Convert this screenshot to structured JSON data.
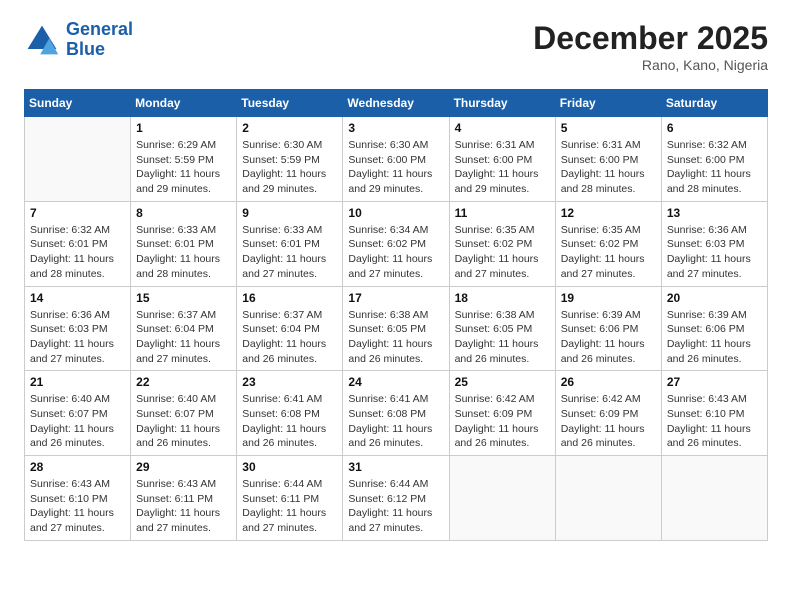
{
  "header": {
    "logo_line1": "General",
    "logo_line2": "Blue",
    "month": "December 2025",
    "location": "Rano, Kano, Nigeria"
  },
  "weekdays": [
    "Sunday",
    "Monday",
    "Tuesday",
    "Wednesday",
    "Thursday",
    "Friday",
    "Saturday"
  ],
  "weeks": [
    [
      {
        "day": "",
        "sunrise": "",
        "sunset": "",
        "daylight": ""
      },
      {
        "day": "1",
        "sunrise": "Sunrise: 6:29 AM",
        "sunset": "Sunset: 5:59 PM",
        "daylight": "Daylight: 11 hours and 29 minutes."
      },
      {
        "day": "2",
        "sunrise": "Sunrise: 6:30 AM",
        "sunset": "Sunset: 5:59 PM",
        "daylight": "Daylight: 11 hours and 29 minutes."
      },
      {
        "day": "3",
        "sunrise": "Sunrise: 6:30 AM",
        "sunset": "Sunset: 6:00 PM",
        "daylight": "Daylight: 11 hours and 29 minutes."
      },
      {
        "day": "4",
        "sunrise": "Sunrise: 6:31 AM",
        "sunset": "Sunset: 6:00 PM",
        "daylight": "Daylight: 11 hours and 29 minutes."
      },
      {
        "day": "5",
        "sunrise": "Sunrise: 6:31 AM",
        "sunset": "Sunset: 6:00 PM",
        "daylight": "Daylight: 11 hours and 28 minutes."
      },
      {
        "day": "6",
        "sunrise": "Sunrise: 6:32 AM",
        "sunset": "Sunset: 6:00 PM",
        "daylight": "Daylight: 11 hours and 28 minutes."
      }
    ],
    [
      {
        "day": "7",
        "sunrise": "Sunrise: 6:32 AM",
        "sunset": "Sunset: 6:01 PM",
        "daylight": "Daylight: 11 hours and 28 minutes."
      },
      {
        "day": "8",
        "sunrise": "Sunrise: 6:33 AM",
        "sunset": "Sunset: 6:01 PM",
        "daylight": "Daylight: 11 hours and 28 minutes."
      },
      {
        "day": "9",
        "sunrise": "Sunrise: 6:33 AM",
        "sunset": "Sunset: 6:01 PM",
        "daylight": "Daylight: 11 hours and 27 minutes."
      },
      {
        "day": "10",
        "sunrise": "Sunrise: 6:34 AM",
        "sunset": "Sunset: 6:02 PM",
        "daylight": "Daylight: 11 hours and 27 minutes."
      },
      {
        "day": "11",
        "sunrise": "Sunrise: 6:35 AM",
        "sunset": "Sunset: 6:02 PM",
        "daylight": "Daylight: 11 hours and 27 minutes."
      },
      {
        "day": "12",
        "sunrise": "Sunrise: 6:35 AM",
        "sunset": "Sunset: 6:02 PM",
        "daylight": "Daylight: 11 hours and 27 minutes."
      },
      {
        "day": "13",
        "sunrise": "Sunrise: 6:36 AM",
        "sunset": "Sunset: 6:03 PM",
        "daylight": "Daylight: 11 hours and 27 minutes."
      }
    ],
    [
      {
        "day": "14",
        "sunrise": "Sunrise: 6:36 AM",
        "sunset": "Sunset: 6:03 PM",
        "daylight": "Daylight: 11 hours and 27 minutes."
      },
      {
        "day": "15",
        "sunrise": "Sunrise: 6:37 AM",
        "sunset": "Sunset: 6:04 PM",
        "daylight": "Daylight: 11 hours and 27 minutes."
      },
      {
        "day": "16",
        "sunrise": "Sunrise: 6:37 AM",
        "sunset": "Sunset: 6:04 PM",
        "daylight": "Daylight: 11 hours and 26 minutes."
      },
      {
        "day": "17",
        "sunrise": "Sunrise: 6:38 AM",
        "sunset": "Sunset: 6:05 PM",
        "daylight": "Daylight: 11 hours and 26 minutes."
      },
      {
        "day": "18",
        "sunrise": "Sunrise: 6:38 AM",
        "sunset": "Sunset: 6:05 PM",
        "daylight": "Daylight: 11 hours and 26 minutes."
      },
      {
        "day": "19",
        "sunrise": "Sunrise: 6:39 AM",
        "sunset": "Sunset: 6:06 PM",
        "daylight": "Daylight: 11 hours and 26 minutes."
      },
      {
        "day": "20",
        "sunrise": "Sunrise: 6:39 AM",
        "sunset": "Sunset: 6:06 PM",
        "daylight": "Daylight: 11 hours and 26 minutes."
      }
    ],
    [
      {
        "day": "21",
        "sunrise": "Sunrise: 6:40 AM",
        "sunset": "Sunset: 6:07 PM",
        "daylight": "Daylight: 11 hours and 26 minutes."
      },
      {
        "day": "22",
        "sunrise": "Sunrise: 6:40 AM",
        "sunset": "Sunset: 6:07 PM",
        "daylight": "Daylight: 11 hours and 26 minutes."
      },
      {
        "day": "23",
        "sunrise": "Sunrise: 6:41 AM",
        "sunset": "Sunset: 6:08 PM",
        "daylight": "Daylight: 11 hours and 26 minutes."
      },
      {
        "day": "24",
        "sunrise": "Sunrise: 6:41 AM",
        "sunset": "Sunset: 6:08 PM",
        "daylight": "Daylight: 11 hours and 26 minutes."
      },
      {
        "day": "25",
        "sunrise": "Sunrise: 6:42 AM",
        "sunset": "Sunset: 6:09 PM",
        "daylight": "Daylight: 11 hours and 26 minutes."
      },
      {
        "day": "26",
        "sunrise": "Sunrise: 6:42 AM",
        "sunset": "Sunset: 6:09 PM",
        "daylight": "Daylight: 11 hours and 26 minutes."
      },
      {
        "day": "27",
        "sunrise": "Sunrise: 6:43 AM",
        "sunset": "Sunset: 6:10 PM",
        "daylight": "Daylight: 11 hours and 26 minutes."
      }
    ],
    [
      {
        "day": "28",
        "sunrise": "Sunrise: 6:43 AM",
        "sunset": "Sunset: 6:10 PM",
        "daylight": "Daylight: 11 hours and 27 minutes."
      },
      {
        "day": "29",
        "sunrise": "Sunrise: 6:43 AM",
        "sunset": "Sunset: 6:11 PM",
        "daylight": "Daylight: 11 hours and 27 minutes."
      },
      {
        "day": "30",
        "sunrise": "Sunrise: 6:44 AM",
        "sunset": "Sunset: 6:11 PM",
        "daylight": "Daylight: 11 hours and 27 minutes."
      },
      {
        "day": "31",
        "sunrise": "Sunrise: 6:44 AM",
        "sunset": "Sunset: 6:12 PM",
        "daylight": "Daylight: 11 hours and 27 minutes."
      },
      {
        "day": "",
        "sunrise": "",
        "sunset": "",
        "daylight": ""
      },
      {
        "day": "",
        "sunrise": "",
        "sunset": "",
        "daylight": ""
      },
      {
        "day": "",
        "sunrise": "",
        "sunset": "",
        "daylight": ""
      }
    ]
  ]
}
